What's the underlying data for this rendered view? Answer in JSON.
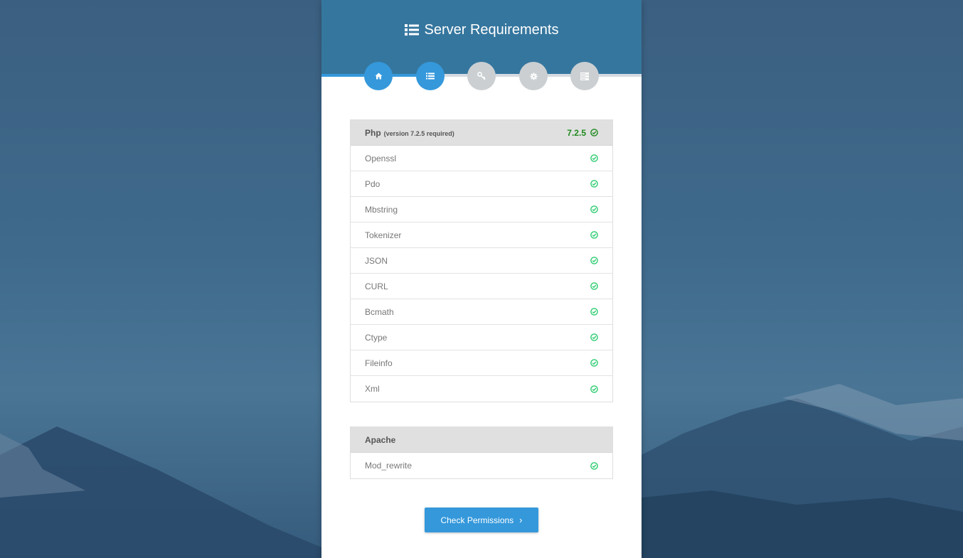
{
  "header": {
    "title": "Server Requirements"
  },
  "steps": [
    {
      "name": "home",
      "icon": "home-icon",
      "active": true
    },
    {
      "name": "requirements",
      "icon": "list-icon",
      "active": true
    },
    {
      "name": "permissions",
      "icon": "key-icon",
      "active": false
    },
    {
      "name": "environment",
      "icon": "gear-icon",
      "active": false
    },
    {
      "name": "database",
      "icon": "server-icon",
      "active": false
    }
  ],
  "php": {
    "label": "Php",
    "required": "(version 7.2.5 required)",
    "version": "7.2.5",
    "items": [
      "Openssl",
      "Pdo",
      "Mbstring",
      "Tokenizer",
      "JSON",
      "CURL",
      "Bcmath",
      "Ctype",
      "Fileinfo",
      "Xml"
    ]
  },
  "apache": {
    "label": "Apache",
    "items": [
      "Mod_rewrite"
    ]
  },
  "button": {
    "label": "Check Permissions",
    "chevron": "›"
  },
  "colors": {
    "accent": "#3498db",
    "header": "#35769e",
    "success": "#2ecc71",
    "version": "#1e8a1e"
  }
}
